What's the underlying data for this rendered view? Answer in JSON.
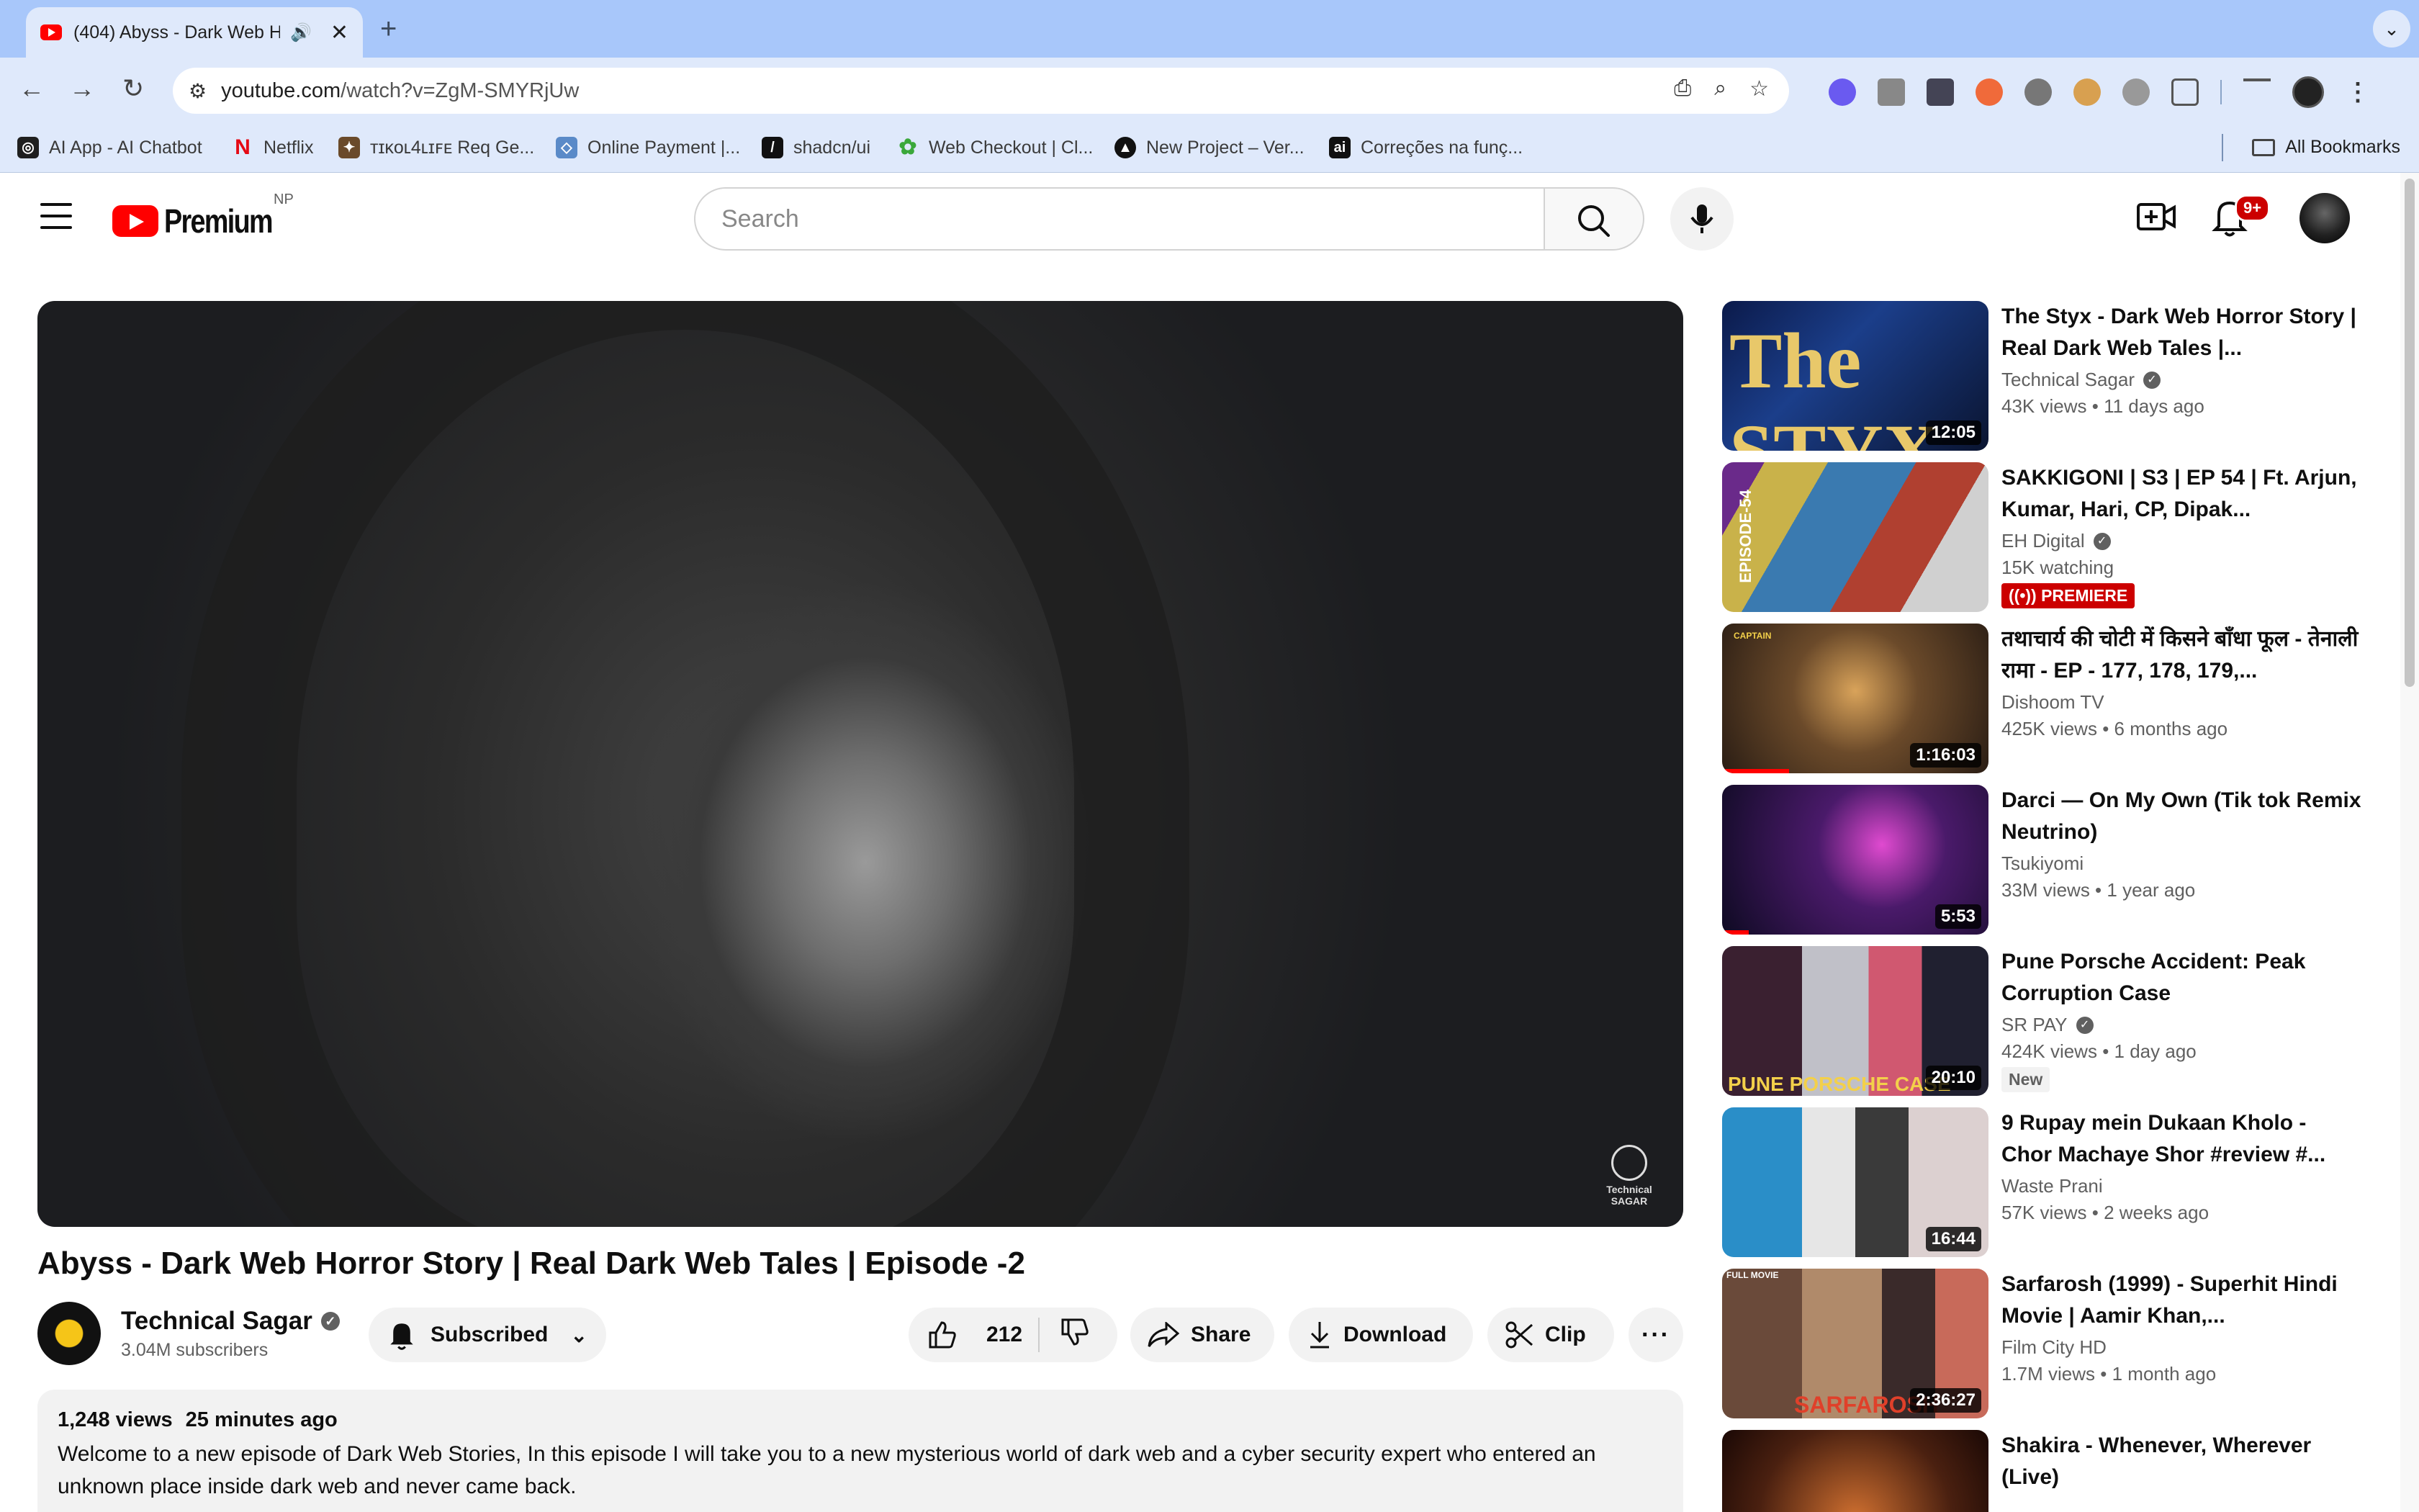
{
  "browser": {
    "tab_title": "(404) Abyss - Dark Web H",
    "tab_audio_icon": "speaker-icon",
    "new_tab_label": "+",
    "url_host": "youtube.com",
    "url_path": "/watch?v=ZgM-SMYRjUw",
    "bookmarks": [
      {
        "label": "AI App - AI Chatbot",
        "color": "#1f1f1f",
        "glyph": "◎"
      },
      {
        "label": "Netflix",
        "color": "#e50914",
        "glyph": "N"
      },
      {
        "label": "ᴛɪᴋᴏʟ4ʟɪꜰᴇ Req Ge...",
        "color": "#6a4a2a",
        "glyph": "✦"
      },
      {
        "label": "Online Payment |...",
        "color": "#5a8ac8",
        "glyph": "◇"
      },
      {
        "label": "shadcn/ui",
        "color": "#111111",
        "glyph": "/"
      },
      {
        "label": "Web Checkout | Cl...",
        "color": "#3aa83a",
        "glyph": "✿"
      },
      {
        "label": "New Project – Ver...",
        "color": "#111111",
        "glyph": "▲"
      },
      {
        "label": "Correções na funç...",
        "color": "#111111",
        "glyph": "ai"
      }
    ],
    "all_bookmarks_label": "All Bookmarks"
  },
  "masthead": {
    "logo_text": "Premium",
    "country_code": "NP",
    "search_placeholder": "Search",
    "notification_count": "9+"
  },
  "video": {
    "title": "Abyss - Dark Web Horror Story | Real Dark Web Tales | Episode -2",
    "channel_name": "Technical Sagar",
    "subscribers": "3.04M subscribers",
    "subscribe_label": "Subscribed",
    "likes": "212",
    "share_label": "Share",
    "download_label": "Download",
    "clip_label": "Clip",
    "more_label": "···",
    "watermark": "Technical SAGAR",
    "views": "1,248 views",
    "posted": "25 minutes ago",
    "description": "Welcome to a new episode of Dark Web Stories, In this episode I will take you to a new mysterious world of dark web and a cyber security expert who entered an unknown place inside dark web and never came back."
  },
  "recommendations": [
    {
      "title": "The Styx - Dark Web Horror Story | Real Dark Web Tales |...",
      "channel": "Technical Sagar",
      "verified": true,
      "views": "43K views",
      "age": "11 days ago",
      "duration": "12:05",
      "thumb_text": "The STYX"
    },
    {
      "title": "SAKKIGONI | S3 | EP 54 | Ft. Arjun, Kumar, Hari, CP, Dipak...",
      "channel": "EH Digital",
      "verified": true,
      "views": "15K watching",
      "age": "",
      "badge": "PREMIERE",
      "thumb_text": "EPISODE-54"
    },
    {
      "title": "तथाचार्य की चोटी में किसने बाँधा फूल - तेनाली रामा - EP - 177, 178, 179,...",
      "channel": "Dishoom TV",
      "verified": false,
      "views": "425K views",
      "age": "6 months ago",
      "duration": "1:16:03",
      "progress": 0.25,
      "thumb_text": "CAPTAIN"
    },
    {
      "title": "Darci — On My Own (Tik tok Remix Neutrino)",
      "channel": "Tsukiyomi",
      "verified": false,
      "views": "33M views",
      "age": "1 year ago",
      "duration": "5:53",
      "progress": 0.1
    },
    {
      "title": "Pune Porsche Accident: Peak Corruption Case",
      "channel": "SR PAY",
      "verified": true,
      "views": "424K views",
      "age": "1 day ago",
      "duration": "20:10",
      "badge": "New",
      "thumb_text": "PUNE PORSCHE CASE"
    },
    {
      "title": "9 Rupay mein Dukaan Kholo - Chor Machaye Shor #review #...",
      "channel": "Waste Prani",
      "verified": false,
      "views": "57K views",
      "age": "2 weeks ago",
      "duration": "16:44"
    },
    {
      "title": "Sarfarosh (1999) - Superhit Hindi Movie | Aamir Khan,...",
      "channel": "Film City HD",
      "verified": false,
      "views": "1.7M views",
      "age": "1 month ago",
      "duration": "2:36:27",
      "thumb_text": "SARFAROSH",
      "thumb_label": "FULL MOVIE"
    },
    {
      "title": "Shakira - Whenever, Wherever (Live)",
      "channel": "",
      "verified": false,
      "views": "",
      "age": ""
    }
  ],
  "colors": {
    "brand_red": "#ff0000",
    "premiere_red": "#cc0000",
    "chrome_blue": "#dfe9fb"
  }
}
